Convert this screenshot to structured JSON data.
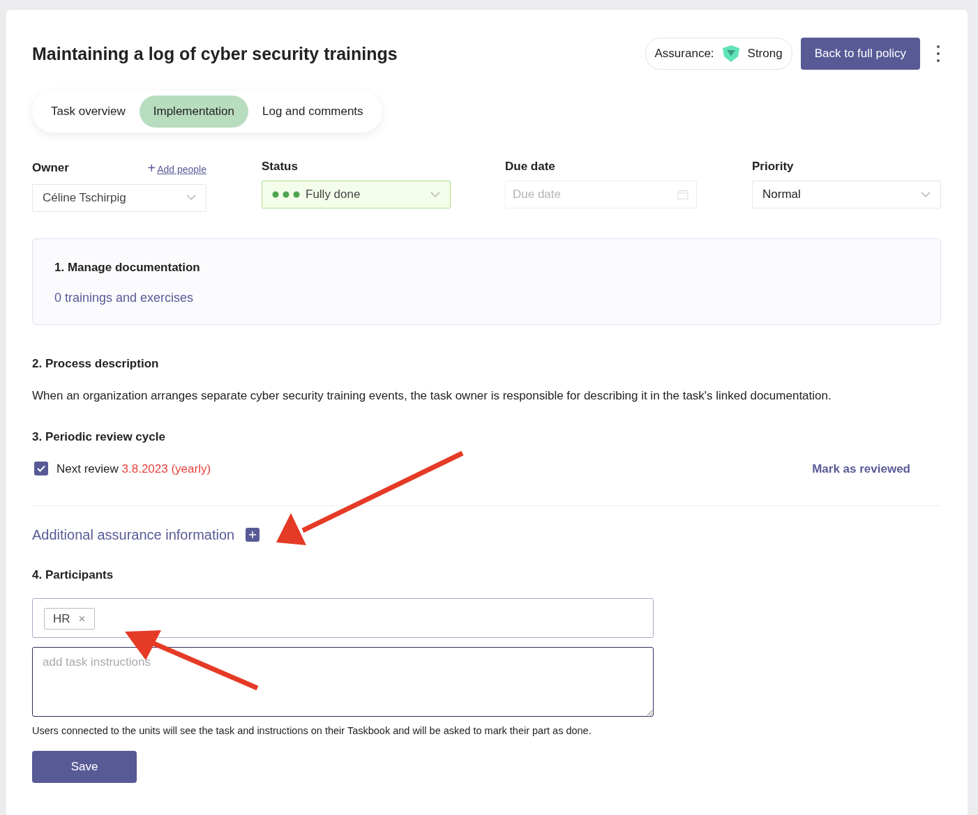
{
  "header": {
    "title": "Maintaining a log of cyber security trainings",
    "assurance": {
      "label": "Assurance:",
      "value": "Strong"
    },
    "back_button": "Back to full policy"
  },
  "tabs": [
    {
      "label": "Task overview",
      "selected": false
    },
    {
      "label": "Implementation",
      "selected": true
    },
    {
      "label": "Log and comments",
      "selected": false
    }
  ],
  "fields": {
    "owner": {
      "label": "Owner",
      "add_link": "Add people",
      "add_icon": "+",
      "value": "Céline Tschirpig"
    },
    "status": {
      "label": "Status",
      "value": "Fully done"
    },
    "due_date": {
      "label": "Due date",
      "placeholder": "Due date"
    },
    "priority": {
      "label": "Priority",
      "value": "Normal"
    }
  },
  "documentation": {
    "title": "1. Manage documentation",
    "link": "0 trainings and exercises"
  },
  "process": {
    "title": "2. Process description",
    "text": "When an organization arranges separate cyber security training events, the task owner is responsible for describing it in the task's linked documentation."
  },
  "review": {
    "title": "3. Periodic review cycle",
    "checked": true,
    "label": "Next review",
    "date": "3.8.2023 (yearly)",
    "action": "Mark as reviewed"
  },
  "additional": {
    "label": "Additional assurance information"
  },
  "participants": {
    "title": "4. Participants",
    "tags": [
      {
        "label": "HR",
        "remove": "×"
      }
    ],
    "instructions_placeholder": "add task instructions",
    "note": "Users connected to the units will see the task and instructions on their Taskbook and will be asked to mark their part as done."
  },
  "save_button": "Save"
}
